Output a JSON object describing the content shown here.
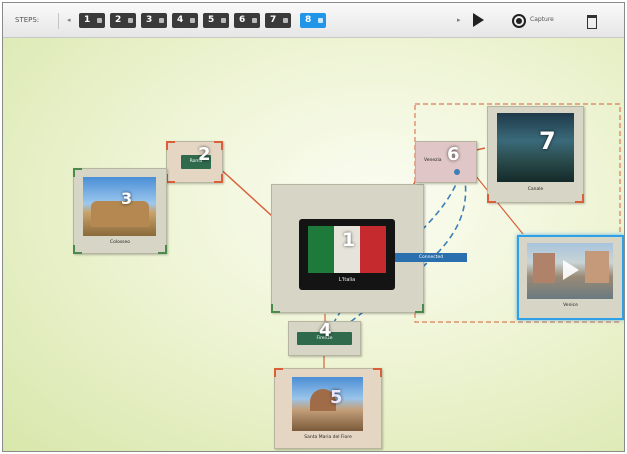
{
  "toolbar": {
    "label": "STEPS:",
    "steps": [
      {
        "label": "1"
      },
      {
        "label": "2"
      },
      {
        "label": "3"
      },
      {
        "label": "4"
      },
      {
        "label": "5"
      },
      {
        "label": "6"
      },
      {
        "label": "7"
      },
      {
        "label": "8"
      }
    ],
    "active_step": 8,
    "record_label": "Capture"
  },
  "nodes": {
    "n1": {
      "number": "1",
      "label": "L'Italia"
    },
    "n2": {
      "number": "2",
      "label": "Roma"
    },
    "n3": {
      "number": "3",
      "label": "Colosseo"
    },
    "n4": {
      "number": "4",
      "label": "Firenze"
    },
    "n5": {
      "number": "5",
      "label": "Santa Maria del Fiore"
    },
    "n6": {
      "number": "6",
      "label": "Venezia"
    },
    "n7": {
      "number": "7",
      "label": "Canale"
    },
    "n8": {
      "label": "Venice"
    }
  },
  "connector": {
    "label": "Connected"
  },
  "colors": {
    "accent": "#2196e8",
    "link": "#d9603b",
    "dashed_link": "#3d7fb8",
    "pill": "#2f6a4d"
  }
}
